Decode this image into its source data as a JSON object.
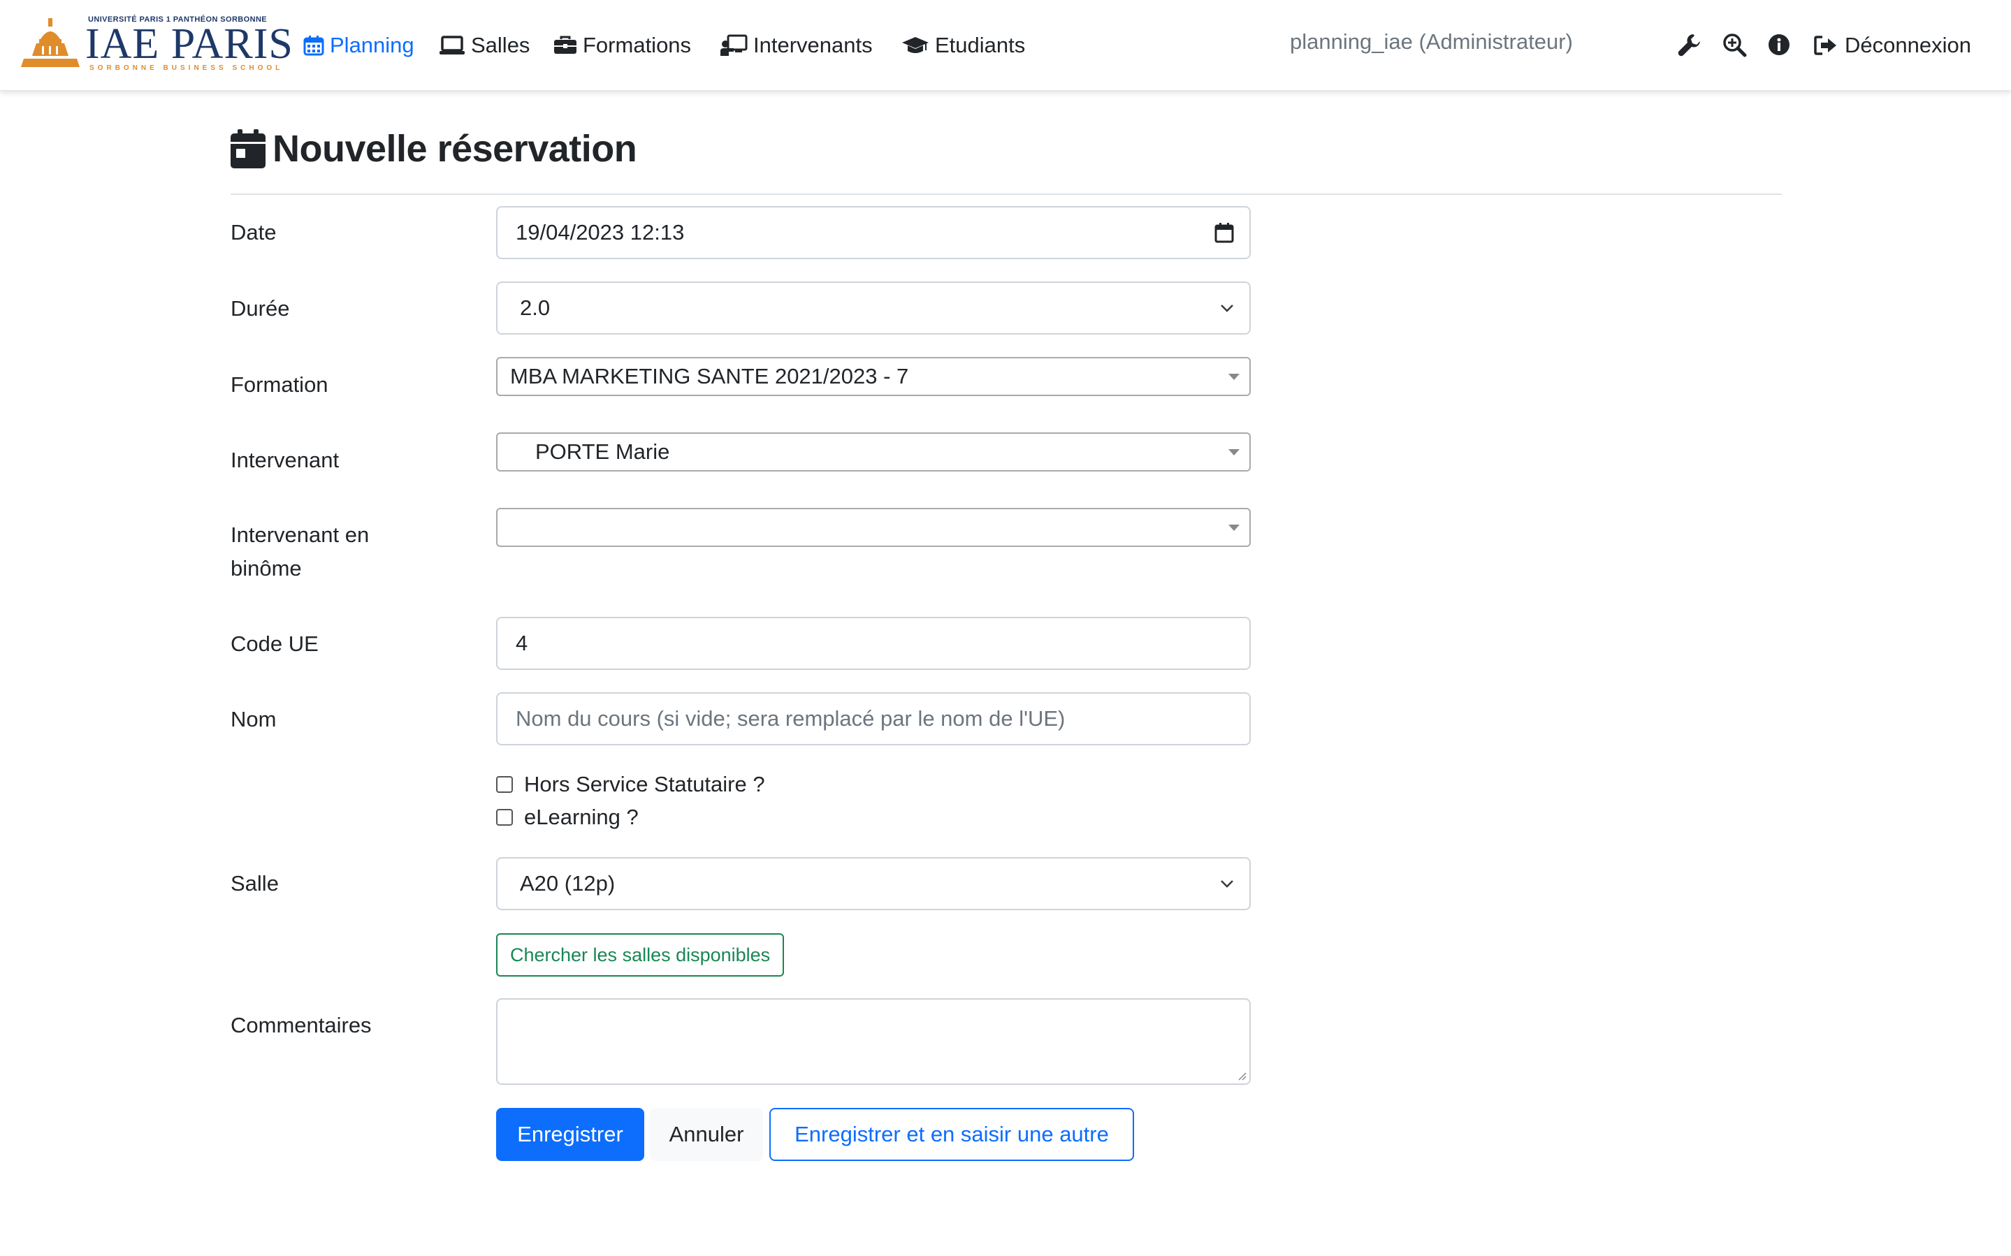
{
  "brand": {
    "top_line": "UNIVERSITÉ PARIS 1 PANTHÉON SORBONNE",
    "name": "IAE PARIS",
    "sub_line": "SORBONNE BUSINESS SCHOOL",
    "color_primary": "#1e3868",
    "color_accent": "#e08c2a"
  },
  "nav": {
    "items": [
      {
        "label": "Planning",
        "icon": "calendar-grid-icon",
        "active": true
      },
      {
        "label": "Salles",
        "icon": "laptop-icon",
        "active": false
      },
      {
        "label": "Formations",
        "icon": "briefcase-icon",
        "active": false
      },
      {
        "label": "Intervenants",
        "icon": "teacher-icon",
        "active": false
      },
      {
        "label": "Etudiants",
        "icon": "graduation-cap-icon",
        "active": false
      }
    ],
    "user": "planning_iae (Administrateur)",
    "tools": [
      "wrench-icon",
      "zoom-in-icon",
      "info-icon"
    ],
    "logout_label": "Déconnexion"
  },
  "page": {
    "title": "Nouvelle réservation",
    "title_icon": "calendar-icon"
  },
  "form": {
    "date": {
      "label": "Date",
      "value": "19/04/2023 12:13"
    },
    "duree": {
      "label": "Durée",
      "value": "2.0"
    },
    "formation": {
      "label": "Formation",
      "value": "MBA MARKETING SANTE 2021/2023 - 7"
    },
    "intervenant": {
      "label": "Intervenant",
      "value": "PORTE Marie"
    },
    "binome": {
      "label_line1": "Intervenant en",
      "label_line2": "binôme",
      "value": ""
    },
    "code_ue": {
      "label": "Code UE",
      "value": "4"
    },
    "nom": {
      "label": "Nom",
      "placeholder": "Nom du cours (si vide; sera remplacé par le nom de l'UE)",
      "value": ""
    },
    "hors_service": {
      "label": "Hors Service Statutaire ?",
      "checked": false
    },
    "elearning": {
      "label": "eLearning ?",
      "checked": false
    },
    "salle": {
      "label": "Salle",
      "value": "A20 (12p)"
    },
    "search_rooms_label": "Chercher les salles disponibles",
    "commentaires": {
      "label": "Commentaires",
      "value": ""
    }
  },
  "actions": {
    "save": "Enregistrer",
    "cancel": "Annuler",
    "save_and_new": "Enregistrer et en saisir une autre"
  },
  "colors": {
    "primary": "#0d6efd",
    "success": "#198754",
    "muted": "#6c757d"
  }
}
